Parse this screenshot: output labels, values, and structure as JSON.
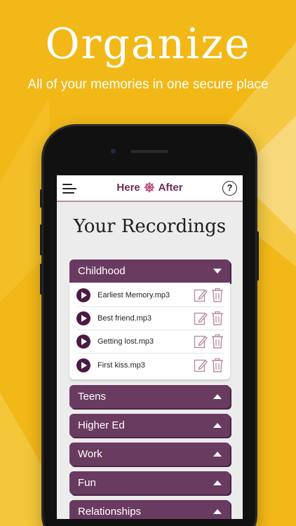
{
  "promo": {
    "headline": "Organize",
    "subheadline": "All of your memories in one secure place"
  },
  "colors": {
    "background": "#f2b818",
    "accent_purple": "#6a3b61",
    "play_button": "#4a1a42",
    "icon_pink": "#b98ea6"
  },
  "app": {
    "logo_left": "Here",
    "logo_right": "After",
    "help_label": "?",
    "page_title": "Your Recordings"
  },
  "sections": [
    {
      "title": "Childhood",
      "expanded": true,
      "recordings": [
        {
          "name": "Earliest Memory.mp3"
        },
        {
          "name": "Best friend.mp3"
        },
        {
          "name": "Getting lost.mp3"
        },
        {
          "name": "First kiss.mp3"
        }
      ]
    },
    {
      "title": "Teens",
      "expanded": false
    },
    {
      "title": "Higher Ed",
      "expanded": false
    },
    {
      "title": "Work",
      "expanded": false
    },
    {
      "title": "Fun",
      "expanded": false
    },
    {
      "title": "Relationships",
      "expanded": false
    }
  ],
  "icons": {
    "menu": "menu-icon",
    "help": "help-icon",
    "play": "play-icon",
    "edit": "edit-icon",
    "delete": "trash-icon",
    "expand": "chevron-down-icon",
    "collapse": "chevron-up-icon"
  }
}
